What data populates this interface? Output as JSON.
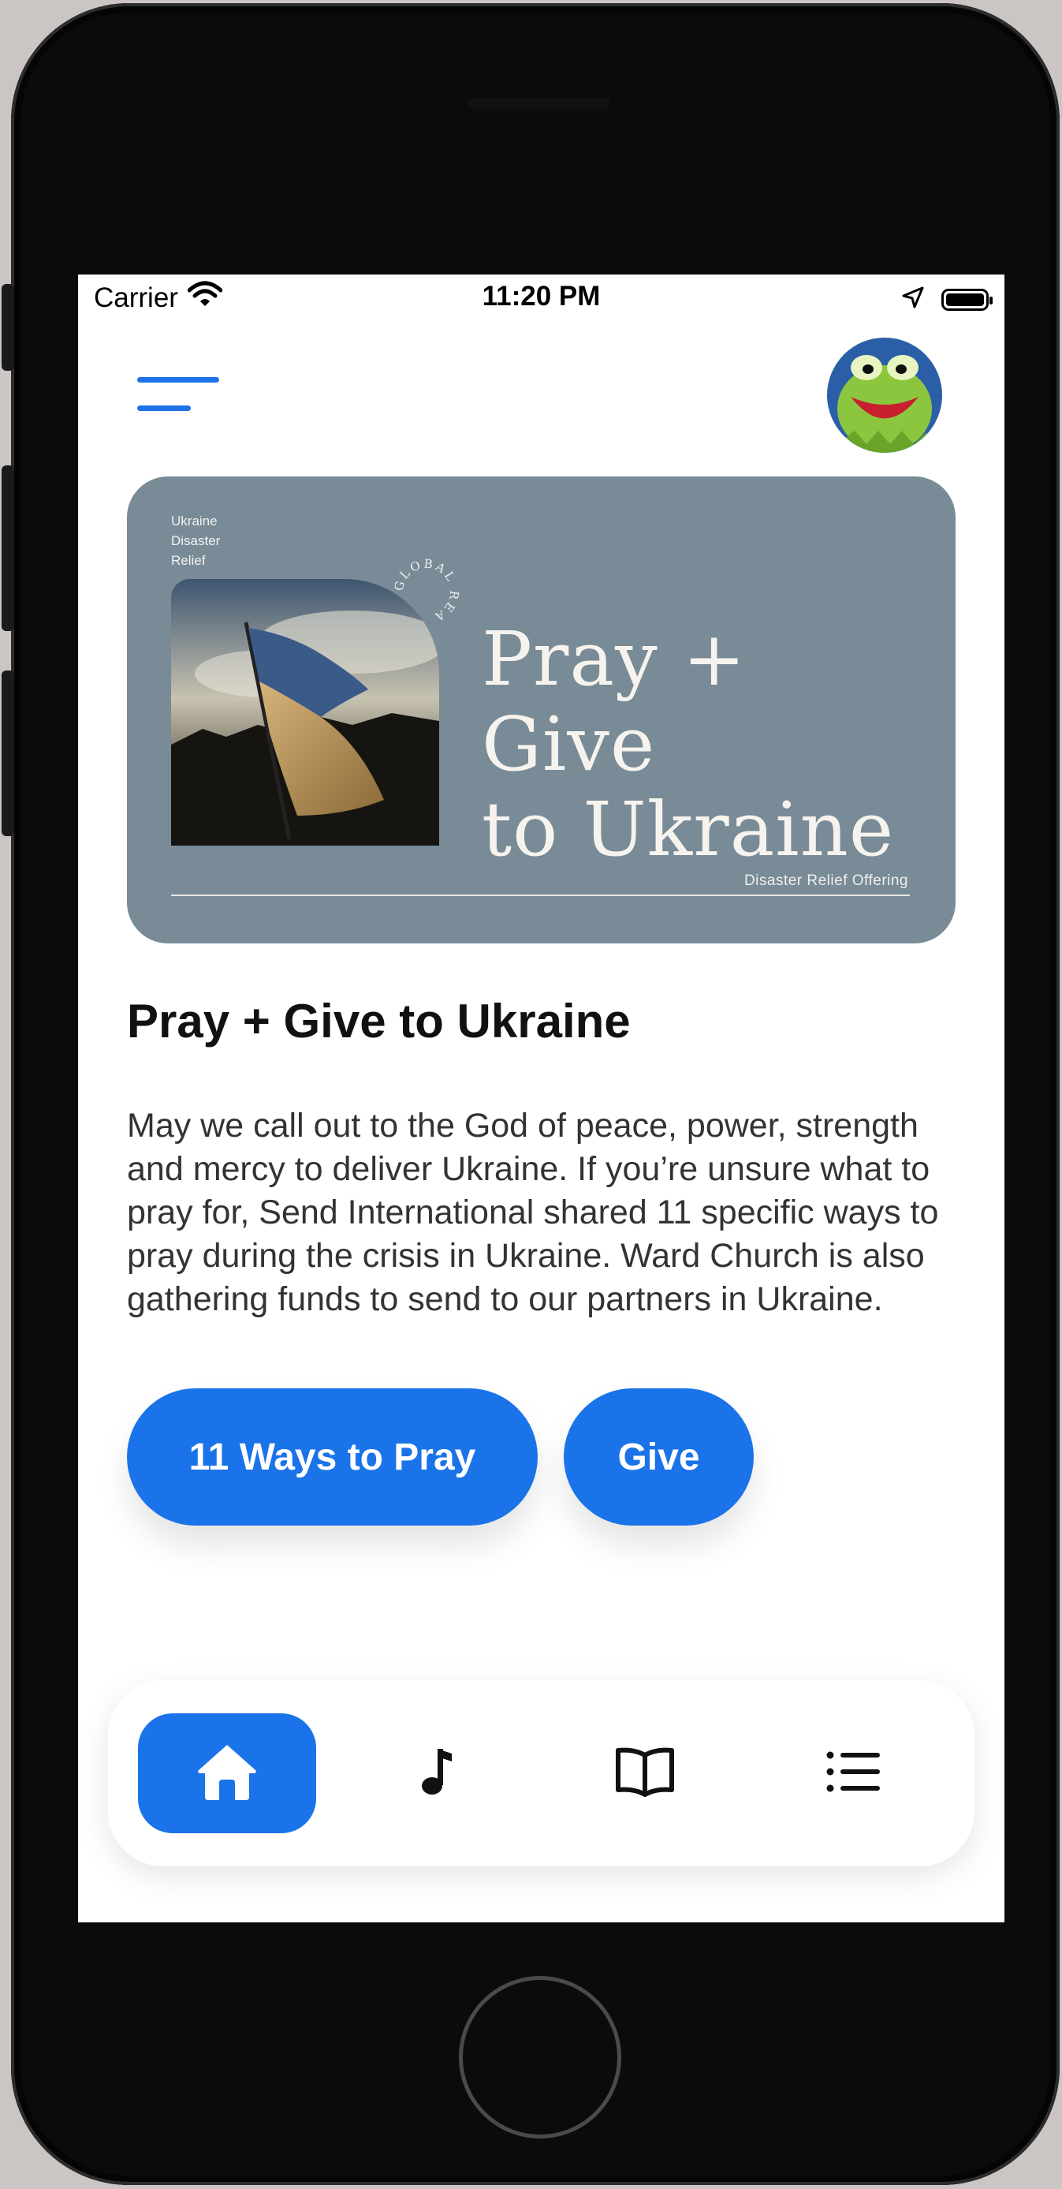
{
  "status_bar": {
    "carrier": "Carrier",
    "time": "11:20 PM"
  },
  "header": {
    "menu_icon": "hamburger-menu-icon",
    "avatar": "profile-avatar"
  },
  "banner": {
    "small_label_line1": "Ukraine",
    "small_label_line2": "Disaster",
    "small_label_line3": "Relief",
    "badge_text": "GLOBAL REACH",
    "title_line1": "Pray + Give",
    "title_line2": "to Ukraine",
    "footer": "Disaster Relief Offering",
    "background_color": "#788b96"
  },
  "content": {
    "title": "Pray + Give to Ukraine",
    "body": "May we call out to the God of peace, power, strength and mercy to deliver Ukraine. If you’re unsure what to pray for, Send International shared 11 specific ways to pray during the crisis in Ukraine. Ward Church is also gathering funds to send to our partners in Ukraine."
  },
  "actions": {
    "pray_label": "11 Ways to Pray",
    "give_label": "Give",
    "accent_color": "#1a73e8"
  },
  "tab_bar": {
    "tabs": [
      {
        "icon": "home-icon",
        "active": true
      },
      {
        "icon": "music-note-icon",
        "active": false
      },
      {
        "icon": "book-icon",
        "active": false
      },
      {
        "icon": "list-icon",
        "active": false
      }
    ]
  }
}
